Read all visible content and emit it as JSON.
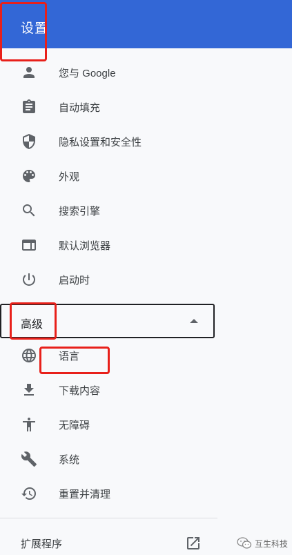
{
  "header": {
    "title": "设置"
  },
  "nav": {
    "items": [
      {
        "label": "您与 Google",
        "icon": "person-icon"
      },
      {
        "label": "自动填充",
        "icon": "clipboard-icon"
      },
      {
        "label": "隐私设置和安全性",
        "icon": "shield-icon"
      },
      {
        "label": "外观",
        "icon": "palette-icon"
      },
      {
        "label": "搜索引擎",
        "icon": "search-icon"
      },
      {
        "label": "默认浏览器",
        "icon": "browser-window-icon"
      },
      {
        "label": "启动时",
        "icon": "power-icon"
      }
    ],
    "advanced": {
      "label": "高级",
      "expanded": true,
      "items": [
        {
          "label": "语言",
          "icon": "globe-icon"
        },
        {
          "label": "下载内容",
          "icon": "download-icon"
        },
        {
          "label": "无障碍",
          "icon": "accessibility-icon"
        },
        {
          "label": "系统",
          "icon": "wrench-icon"
        },
        {
          "label": "重置并清理",
          "icon": "restore-icon"
        }
      ]
    },
    "extensions": {
      "label": "扩展程序",
      "icon": "open-in-new-icon"
    }
  },
  "watermark": {
    "text": "互生科技"
  },
  "colors": {
    "header_bg": "#3367d6",
    "header_text": "#ffffff",
    "page_bg": "#f8f9fb",
    "icon": "#5f6368",
    "annotation": "#e8201a"
  }
}
